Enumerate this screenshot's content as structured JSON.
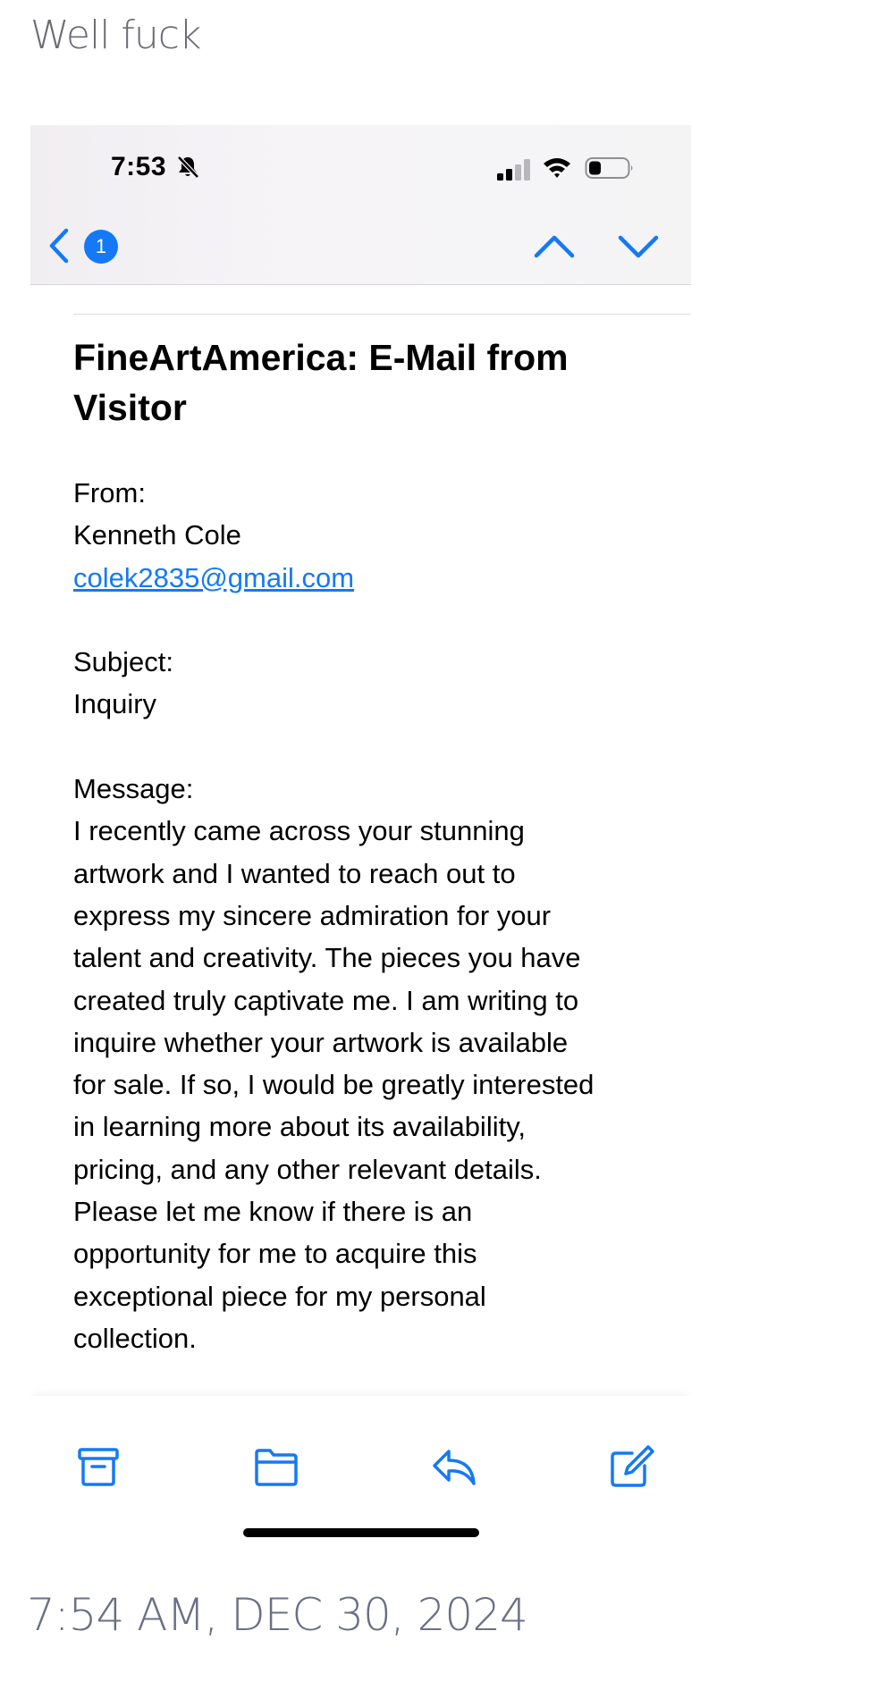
{
  "post": {
    "title": "Well fuck",
    "timestamp": "7:54 AM, DEC 30, 2024"
  },
  "status_bar": {
    "time": "7:53",
    "icons": [
      "bell-slash-icon",
      "signal-icon",
      "wifi-icon",
      "battery-icon"
    ]
  },
  "nav": {
    "back_icon": "chevron-left-icon",
    "badge_count": "1",
    "up_icon": "chevron-up-icon",
    "down_icon": "chevron-down-icon"
  },
  "email": {
    "subject_lines": [
      "FineArtAmerica: E-Mail from",
      "Visitor"
    ],
    "from_label": "From:",
    "from_name": "Kenneth Cole",
    "from_email": "colek2835@gmail.com",
    "subject_label": "Subject:",
    "subject_value": "Inquiry",
    "message_label": "Message:",
    "message_lines": [
      "I recently came across your stunning",
      "artwork and I wanted to reach out to",
      "express my sincere admiration for your",
      "talent and creativity. The pieces you have",
      "created truly captivate me. I am writing to",
      "inquire whether your artwork is available",
      "for sale. If so, I would be greatly interested",
      "in learning more about its availability,",
      "pricing, and any other relevant details.",
      "Please let me know if there is an",
      "opportunity for me to acquire this",
      "exceptional piece for my personal",
      "collection."
    ]
  },
  "toolbar": {
    "icons": [
      "archive-icon",
      "folder-icon",
      "reply-icon",
      "compose-icon"
    ]
  },
  "colors": {
    "accent": "#1479f6",
    "caption": "#6b6b73"
  }
}
